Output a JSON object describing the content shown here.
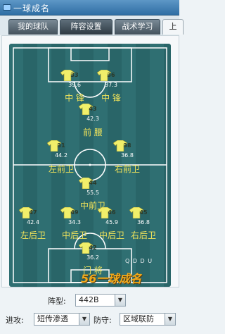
{
  "window": {
    "title": "一球成名"
  },
  "tabs": [
    {
      "label": "我的球队"
    },
    {
      "label": "阵容设置"
    },
    {
      "label": "战术学习"
    },
    {
      "label": "上"
    }
  ],
  "colors": {
    "pitch": "#2f6f72",
    "jersey": "#f1ef6a",
    "label": "#f0e35a"
  },
  "players": [
    {
      "number": "33",
      "rating": "39.6"
    },
    {
      "number": "36",
      "rating": "37.3"
    },
    {
      "number": "43",
      "rating": "42.3"
    },
    {
      "number": "31",
      "rating": "44.2"
    },
    {
      "number": "38",
      "rating": "36.8"
    },
    {
      "number": "44",
      "rating": "55.5"
    },
    {
      "number": "47",
      "rating": "42.4"
    },
    {
      "number": "49",
      "rating": "34.3"
    },
    {
      "number": "46",
      "rating": "45.9"
    },
    {
      "number": "45",
      "rating": "36.8"
    },
    {
      "number": "42",
      "rating": "36.2"
    }
  ],
  "positions": {
    "cf_left": "中 锋",
    "cf_right": "中 锋",
    "am": "前 腰",
    "lm": "左前卫",
    "rm": "右前卫",
    "cm": "中前卫",
    "lb": "左后卫",
    "cb_left": "中后卫",
    "cb_right": "中后卫",
    "rb": "右后卫",
    "gk": "门 将"
  },
  "watermark": "Q D D U",
  "logo": "56一球成名",
  "formation": {
    "label": "阵型:",
    "value": "442B"
  },
  "attack": {
    "label": "进攻:",
    "value": "短传渗透"
  },
  "defense": {
    "label": "防守:",
    "value": "区域联防"
  }
}
